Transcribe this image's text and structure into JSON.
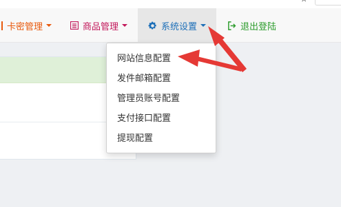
{
  "nav": {
    "card_label": "卡密管理",
    "card_color": "#e8590c",
    "goods_label": "商品管理",
    "goods_color": "#c2185b",
    "system_label": "系统设置",
    "system_color": "#1d6fb8",
    "logout_label": "退出登陆",
    "logout_color": "#2e9d2e"
  },
  "dropdown": {
    "items": [
      {
        "label": "网站信息配置"
      },
      {
        "label": "发件邮箱配置"
      },
      {
        "label": "管理员账号配置"
      },
      {
        "label": "支付接口配置"
      },
      {
        "label": "提现配置"
      }
    ]
  },
  "annotation": {
    "arrow_color": "#e53935"
  }
}
